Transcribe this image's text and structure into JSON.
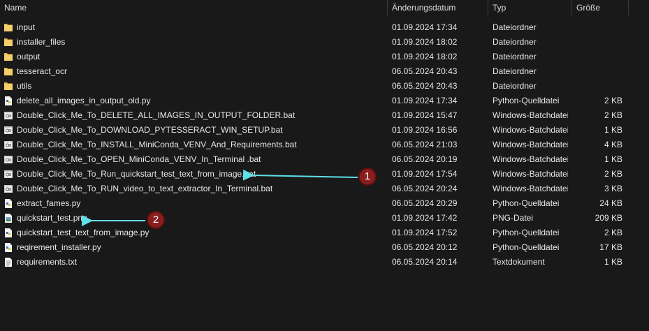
{
  "columns": {
    "name": "Name",
    "date": "Änderungsdatum",
    "type": "Typ",
    "size": "Größe",
    "sort_caret": "^"
  },
  "rows": [
    {
      "name": "input",
      "date": "01.09.2024 17:34",
      "type": "Dateiordner",
      "size": "",
      "icon": "folder-icon"
    },
    {
      "name": "installer_files",
      "date": "01.09.2024 18:02",
      "type": "Dateiordner",
      "size": "",
      "icon": "folder-icon"
    },
    {
      "name": "output",
      "date": "01.09.2024 18:02",
      "type": "Dateiordner",
      "size": "",
      "icon": "folder-icon"
    },
    {
      "name": "tesseract_ocr",
      "date": "06.05.2024 20:43",
      "type": "Dateiordner",
      "size": "",
      "icon": "folder-icon"
    },
    {
      "name": "utils",
      "date": "06.05.2024 20:43",
      "type": "Dateiordner",
      "size": "",
      "icon": "folder-icon"
    },
    {
      "name": "delete_all_images_in_output_old.py",
      "date": "01.09.2024 17:34",
      "type": "Python-Quelldatei",
      "size": "2 KB",
      "icon": "python-file-icon"
    },
    {
      "name": "Double_Click_Me_To_DELETE_ALL_IMAGES_IN_OUTPUT_FOLDER.bat",
      "date": "01.09.2024 15:47",
      "type": "Windows-Batchdatei",
      "size": "2 KB",
      "icon": "batch-file-icon"
    },
    {
      "name": "Double_Click_Me_To_DOWNLOAD_PYTESSERACT_WIN_SETUP.bat",
      "date": "01.09.2024 16:56",
      "type": "Windows-Batchdatei",
      "size": "1 KB",
      "icon": "batch-file-icon"
    },
    {
      "name": "Double_Click_Me_To_INSTALL_MiniConda_VENV_And_Requirements.bat",
      "date": "06.05.2024 21:03",
      "type": "Windows-Batchdatei",
      "size": "4 KB",
      "icon": "batch-file-icon"
    },
    {
      "name": "Double_Click_Me_To_OPEN_MiniConda_VENV_In_Terminal .bat",
      "date": "06.05.2024 20:19",
      "type": "Windows-Batchdatei",
      "size": "1 KB",
      "icon": "batch-file-icon"
    },
    {
      "name": "Double_Click_Me_To_Run_quickstart_test_text_from_image.bat",
      "date": "01.09.2024 17:54",
      "type": "Windows-Batchdatei",
      "size": "2 KB",
      "icon": "batch-file-icon"
    },
    {
      "name": "Double_Click_Me_To_RUN_video_to_text_extractor_In_Terminal.bat",
      "date": "06.05.2024 20:24",
      "type": "Windows-Batchdatei",
      "size": "3 KB",
      "icon": "batch-file-icon"
    },
    {
      "name": "extract_fames.py",
      "date": "06.05.2024 20:29",
      "type": "Python-Quelldatei",
      "size": "24 KB",
      "icon": "python-file-icon"
    },
    {
      "name": "quickstart_test.png",
      "date": "01.09.2024 17:42",
      "type": "PNG-Datei",
      "size": "209 KB",
      "icon": "image-file-icon"
    },
    {
      "name": "quickstart_test_text_from_image.py",
      "date": "01.09.2024 17:52",
      "type": "Python-Quelldatei",
      "size": "2 KB",
      "icon": "python-file-icon"
    },
    {
      "name": "reqirement_installer.py",
      "date": "06.05.2024 20:12",
      "type": "Python-Quelldatei",
      "size": "17 KB",
      "icon": "python-file-icon"
    },
    {
      "name": "requirements.txt",
      "date": "06.05.2024 20:14",
      "type": "Textdokument",
      "size": "1 KB",
      "icon": "text-file-icon"
    }
  ],
  "annotations": [
    {
      "label": "1"
    },
    {
      "label": "2"
    }
  ],
  "colors": {
    "background": "#191919",
    "folder": "#f2c55c",
    "arrow": "#5fe0e8",
    "callout": "#8a1e1e"
  }
}
